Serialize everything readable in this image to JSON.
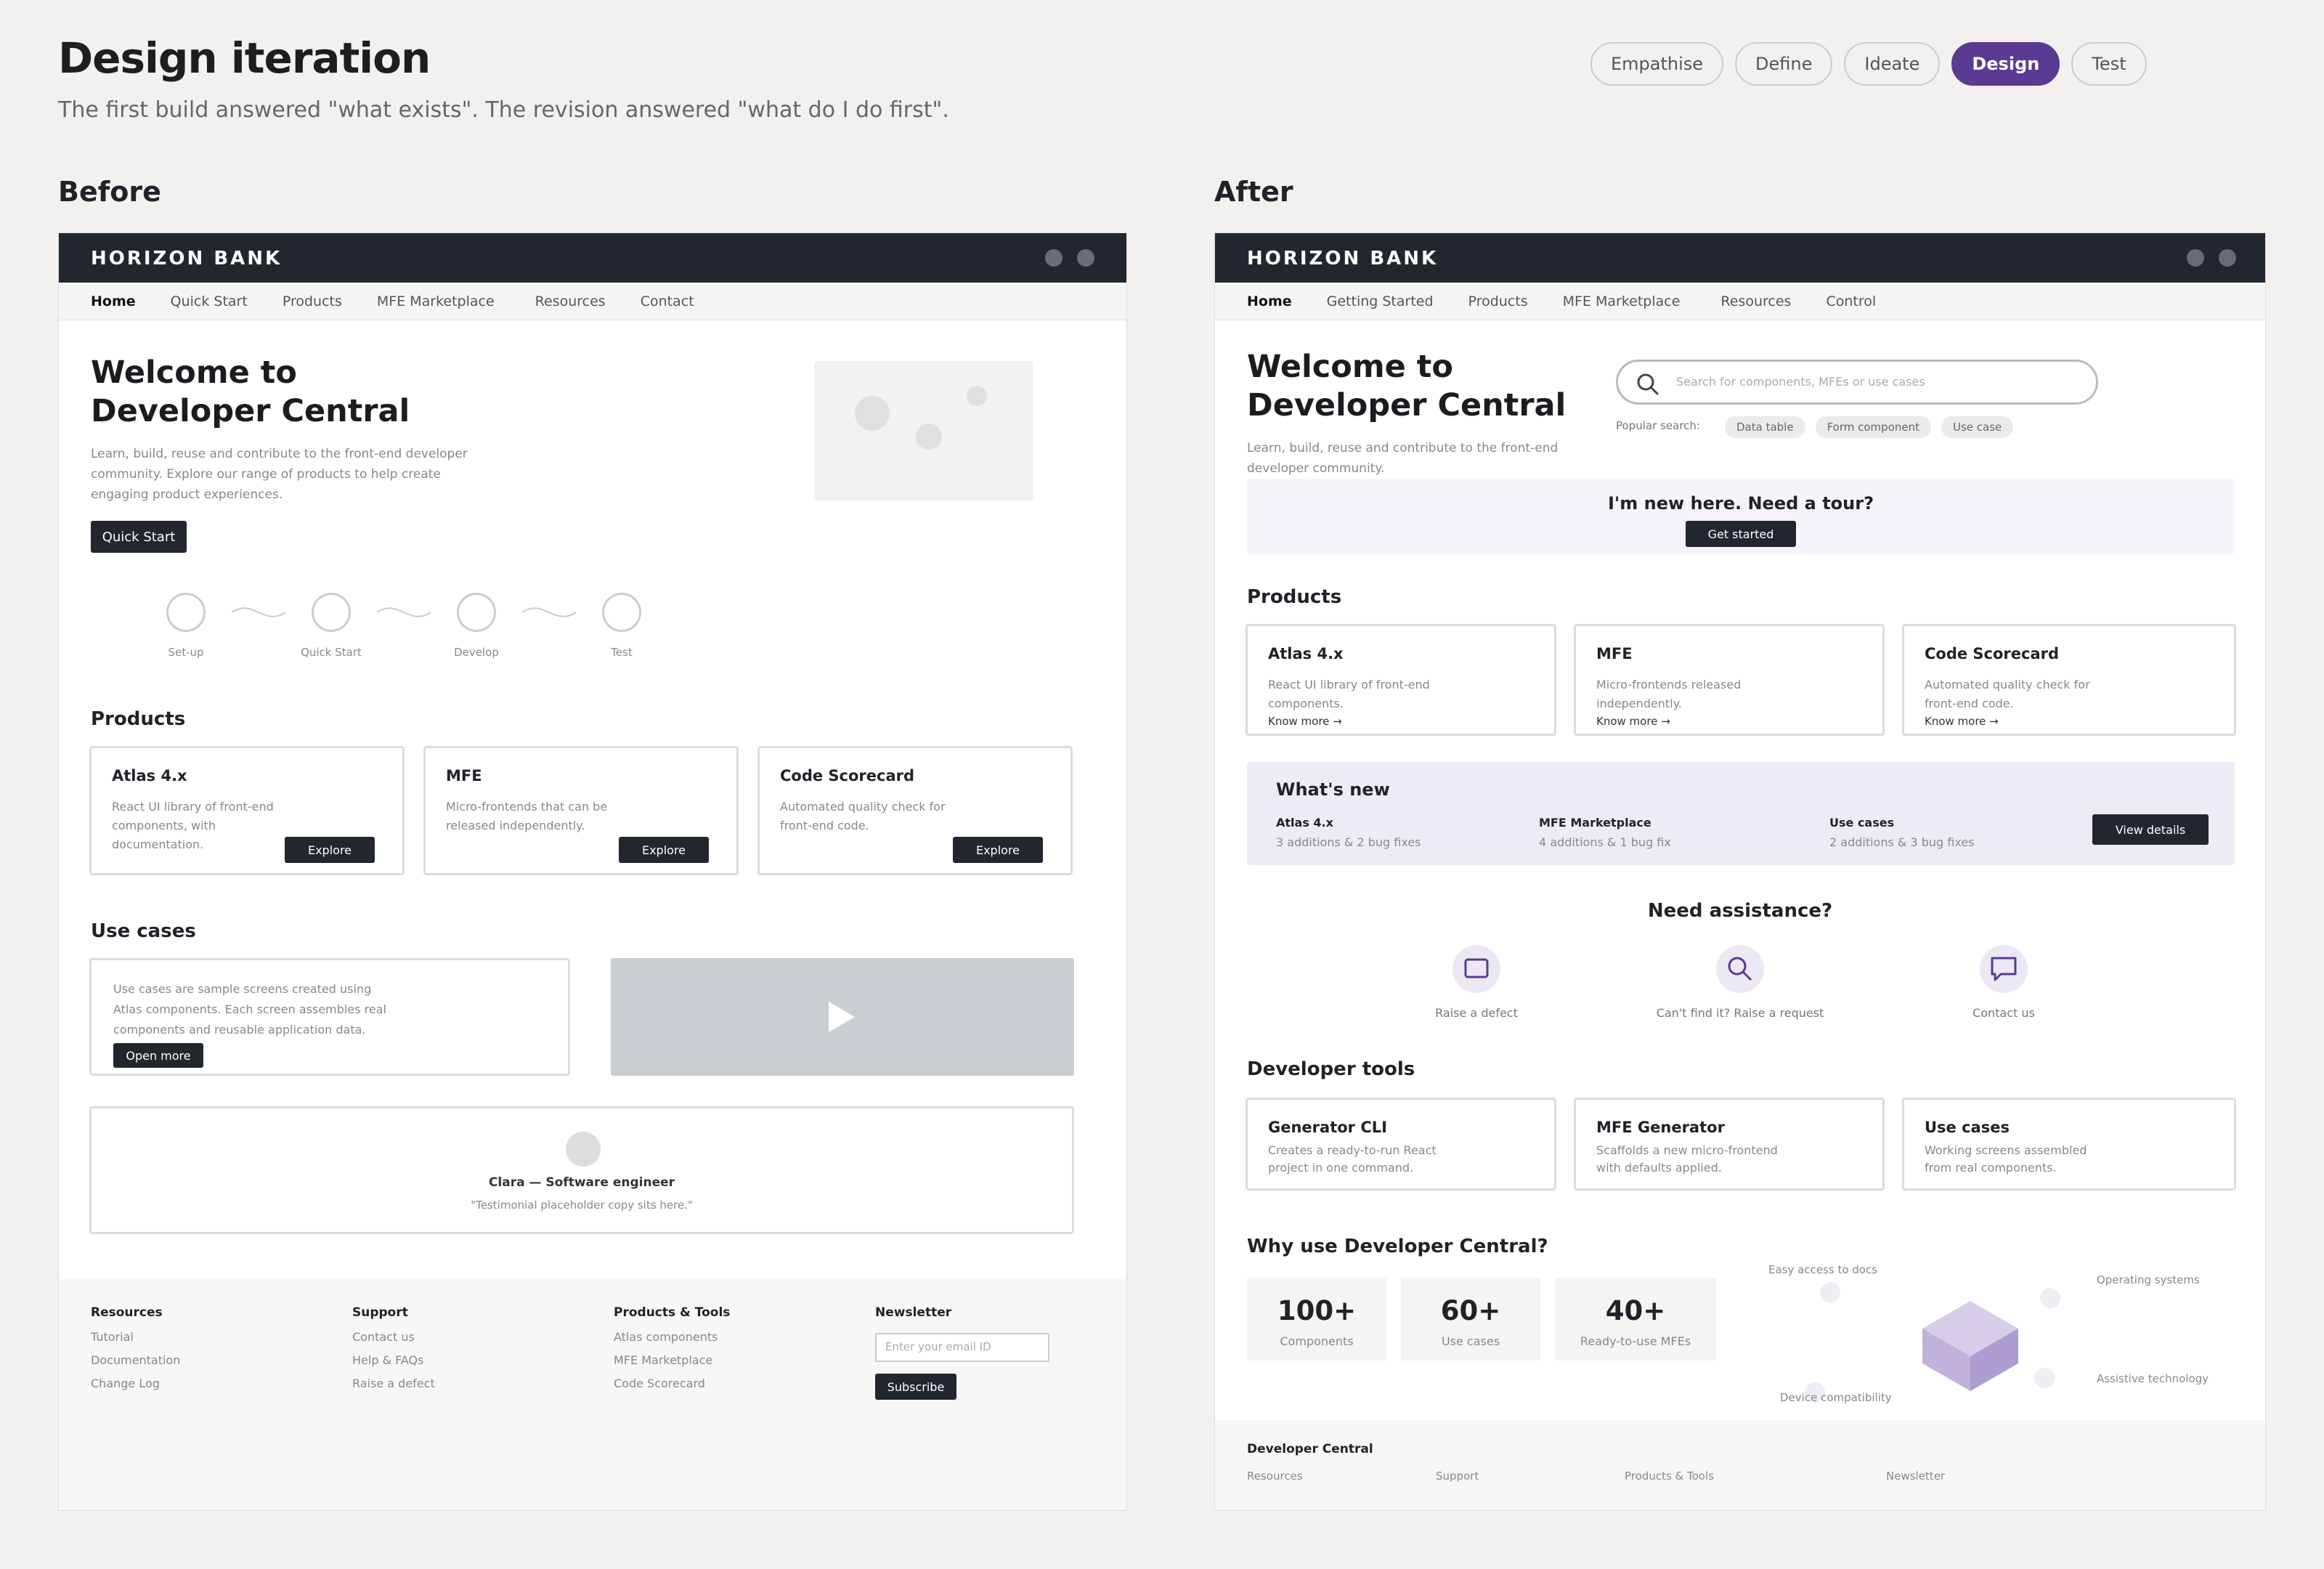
{
  "header": {
    "title": "Design iteration",
    "subtitle": "The first build answered \"what exists\". The revision answered \"what do I do first\"."
  },
  "phases": [
    "Empathise",
    "Define",
    "Ideate",
    "Design",
    "Test"
  ],
  "active_phase": "Design",
  "before": {
    "label": "Before",
    "brand": "HORIZON BANK",
    "nav": [
      "Home",
      "Quick Start",
      "Products",
      "MFE Marketplace",
      "Resources",
      "Contact"
    ],
    "hero_title_1": "Welcome to",
    "hero_title_2": "Developer Central",
    "hero_text_1": "Learn, build, reuse and contribute to the front-end developer",
    "hero_text_2": "community. Explore our range of products to help create",
    "hero_text_3": "engaging product experiences.",
    "hero_button": "Quick Start",
    "steps": [
      "Set-up",
      "Quick Start",
      "Develop",
      "Test"
    ],
    "products_title": "Products",
    "products": [
      {
        "title": "Atlas 4.x",
        "desc1": "React UI library of front-end",
        "desc2": "components, with documentation.",
        "button": "Explore"
      },
      {
        "title": "MFE",
        "desc1": "Micro-frontends that can be",
        "desc2": "released independently.",
        "button": "Explore"
      },
      {
        "title": "Code Scorecard",
        "desc1": "Automated quality check for",
        "desc2": "front-end code.",
        "button": "Explore"
      }
    ],
    "usecases_title": "Use cases",
    "usecase_text_1": "Use cases are sample screens created using",
    "usecase_text_2": "Atlas components. Each screen assembles real",
    "usecase_text_3": "components and reusable application data.",
    "usecase_button": "Open more",
    "testimonial_name": "Clara — Software engineer",
    "testimonial_quote": "\"Testimonial placeholder copy sits here.\"",
    "footer": {
      "columns": [
        {
          "title": "Resources",
          "links": [
            "Tutorial",
            "Documentation",
            "Change Log"
          ]
        },
        {
          "title": "Support",
          "links": [
            "Contact us",
            "Help & FAQs",
            "Raise a defect"
          ]
        },
        {
          "title": "Products & Tools",
          "links": [
            "Atlas components",
            "MFE Marketplace",
            "Code Scorecard"
          ]
        }
      ],
      "newsletter_title": "Newsletter",
      "newsletter_placeholder": "Enter your email ID",
      "subscribe": "Subscribe"
    }
  },
  "after": {
    "label": "After",
    "brand": "HORIZON BANK",
    "nav": [
      "Home",
      "Getting Started",
      "Products",
      "MFE Marketplace",
      "Resources",
      "Control"
    ],
    "hero_title_1": "Welcome to",
    "hero_title_2": "Developer Central",
    "hero_text_1": "Learn, build, reuse and contribute to the front-end",
    "hero_text_2": "developer community.",
    "search_placeholder": "Search for components, MFEs or use cases",
    "popular_label": "Popular search:",
    "popular": [
      "Data table",
      "Form component",
      "Use case"
    ],
    "tour_title": "I'm new here. Need a tour?",
    "tour_button": "Get started",
    "products_title": "Products",
    "products": [
      {
        "title": "Atlas 4.x",
        "desc1": "React UI library of front-end",
        "desc2": "components.",
        "link": "Know more →"
      },
      {
        "title": "MFE",
        "desc1": "Micro-frontends released",
        "desc2": "independently.",
        "link": "Know more →"
      },
      {
        "title": "Code Scorecard",
        "desc1": "Automated quality check for",
        "desc2": "front-end code.",
        "link": "Know more →"
      }
    ],
    "whatsnew_title": "What's new",
    "whatsnew": [
      {
        "title": "Atlas 4.x",
        "desc": "3 additions & 2 bug fixes"
      },
      {
        "title": "MFE Marketplace",
        "desc": "4 additions & 1 bug fix"
      },
      {
        "title": "Use cases",
        "desc": "2 additions & 3 bug fixes"
      }
    ],
    "whatsnew_button": "View details",
    "assist_title": "Need assistance?",
    "assist": [
      "Raise a defect",
      "Can't find it? Raise a request",
      "Contact us"
    ],
    "tools_title": "Developer tools",
    "tools": [
      {
        "title": "Generator CLI",
        "desc1": "Creates a ready-to-run React",
        "desc2": "project in one command."
      },
      {
        "title": "MFE Generator",
        "desc1": "Scaffolds a new micro-frontend",
        "desc2": "with defaults applied."
      },
      {
        "title": "Use cases",
        "desc1": "Working screens assembled",
        "desc2": "from real components."
      }
    ],
    "why_title": "Why use Developer Central?",
    "stats": [
      {
        "value": "100+",
        "label": "Components"
      },
      {
        "value": "60+",
        "label": "Use cases"
      },
      {
        "value": "40+",
        "label": "Ready-to-use MFEs"
      }
    ],
    "benefits": [
      "Easy access to docs",
      "Operating systems",
      "Assistive technology",
      "Device compatibility"
    ],
    "footer_title": "Developer Central",
    "footer_links": [
      "Resources",
      "Support",
      "Products & Tools",
      "Newsletter"
    ]
  },
  "colors": {
    "accent": "#5a3a92",
    "dark": "#22262e",
    "tint": "#f6f4fa",
    "tint2": "#efebf6"
  }
}
